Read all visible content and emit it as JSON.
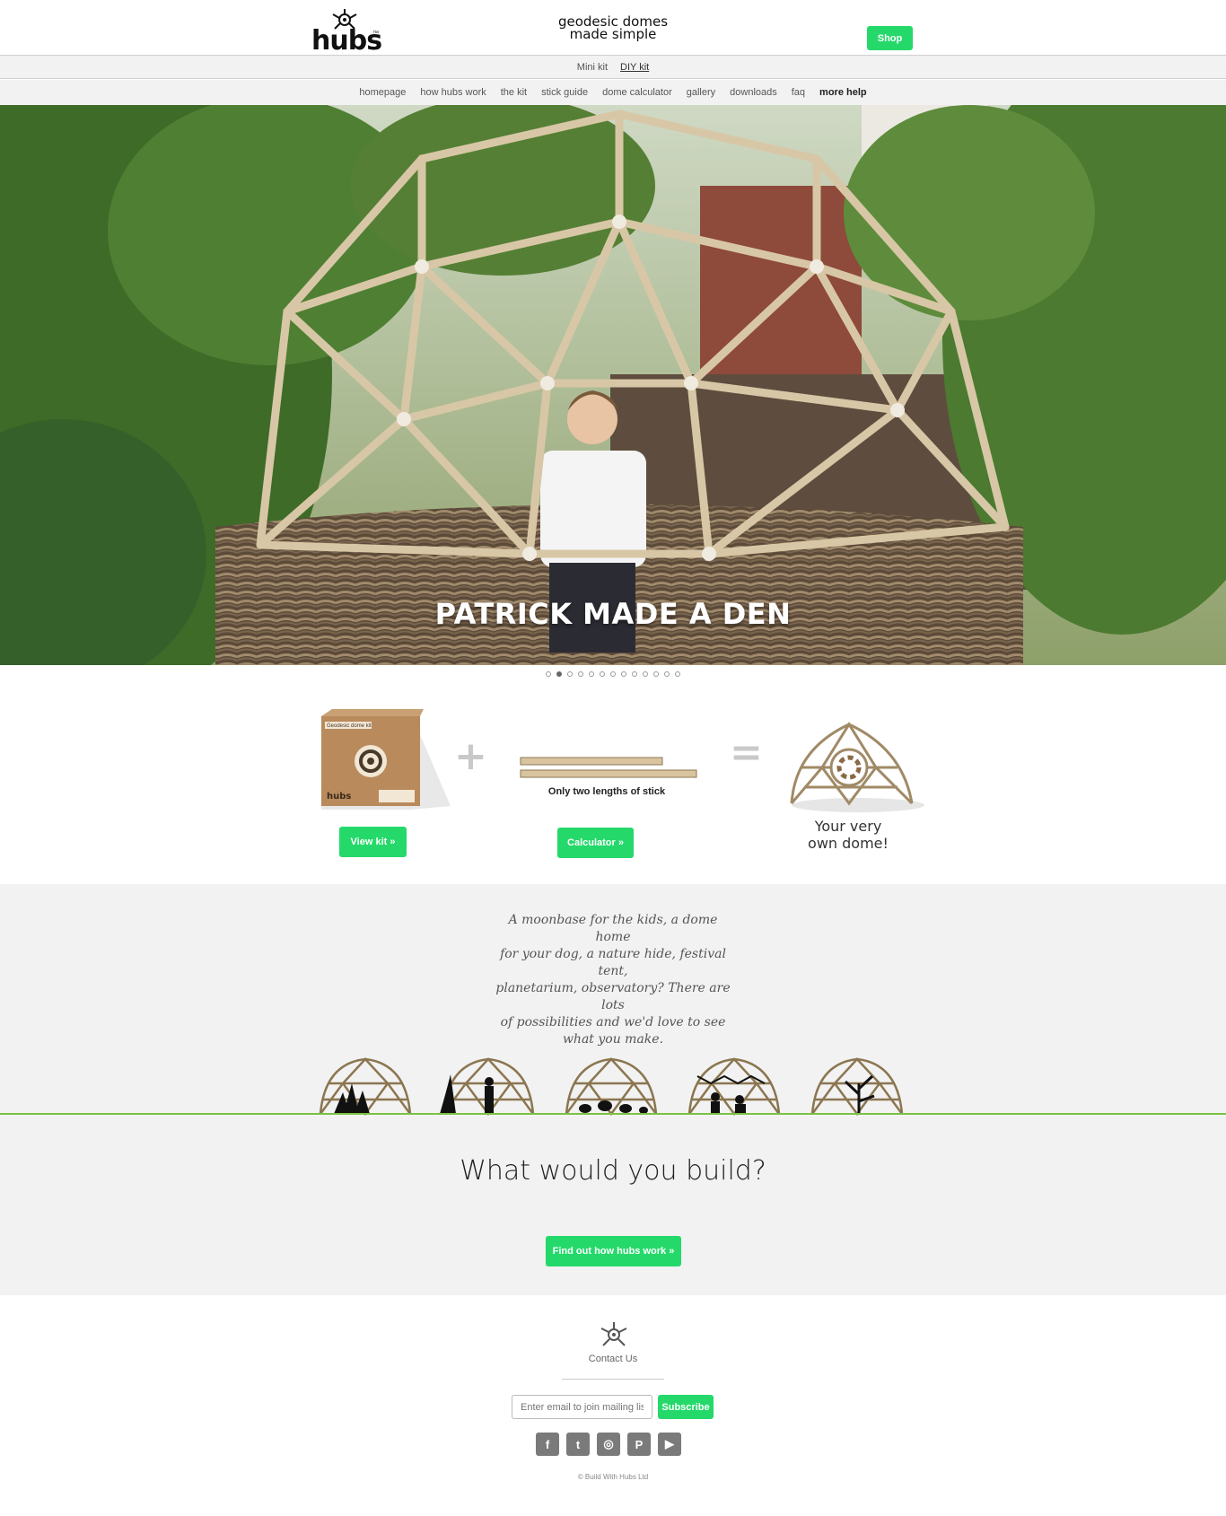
{
  "header": {
    "logo_text": "hubs",
    "logo_tm": "™",
    "tagline_line1": "geodesic domes",
    "tagline_line2": "made simple",
    "shop_label": "Shop"
  },
  "subnav": {
    "items": [
      "Mini kit",
      "DIY kit"
    ]
  },
  "nav": {
    "items": [
      "homepage",
      "how hubs work",
      "the kit",
      "stick guide",
      "dome calculator",
      "gallery",
      "downloads",
      "faq",
      "more help"
    ]
  },
  "hero": {
    "caption": "PATRICK MADE A DEN",
    "slide_count": 13,
    "active_slide": 2
  },
  "equation": {
    "kit_box_title": "Geodesic dome kit",
    "kit_box_brand": "hubs",
    "plus": "+",
    "equals": "=",
    "stick_label": "Only two lengths of stick",
    "view_kit_label": "View kit »",
    "calculator_label": "Calculator »",
    "own_dome_line1": "Your very",
    "own_dome_line2": "own dome!"
  },
  "ideas": {
    "quote_lines": [
      "A moonbase for the kids, a dome home",
      "for your dog, a nature hide, festival tent,",
      "planetarium, observatory? There are lots",
      "of possibilities and we'd love to see",
      "what you make."
    ],
    "title": "What would you build?",
    "cta_label": "Find out how hubs work »"
  },
  "footer": {
    "contact_label": "Contact Us",
    "email_placeholder": "Enter email to join mailing list",
    "subscribe_label": "Subscribe",
    "social": [
      {
        "name": "facebook-icon",
        "glyph": "f"
      },
      {
        "name": "twitter-icon",
        "glyph": "t"
      },
      {
        "name": "instagram-icon",
        "glyph": "◎"
      },
      {
        "name": "pinterest-icon",
        "glyph": "P"
      },
      {
        "name": "youtube-icon",
        "glyph": "▶"
      }
    ],
    "copyright": "© Build With Hubs Ltd"
  },
  "colors": {
    "accent": "#24d96a",
    "green_line": "#7cc142",
    "grey_band": "#f2f2f2"
  }
}
